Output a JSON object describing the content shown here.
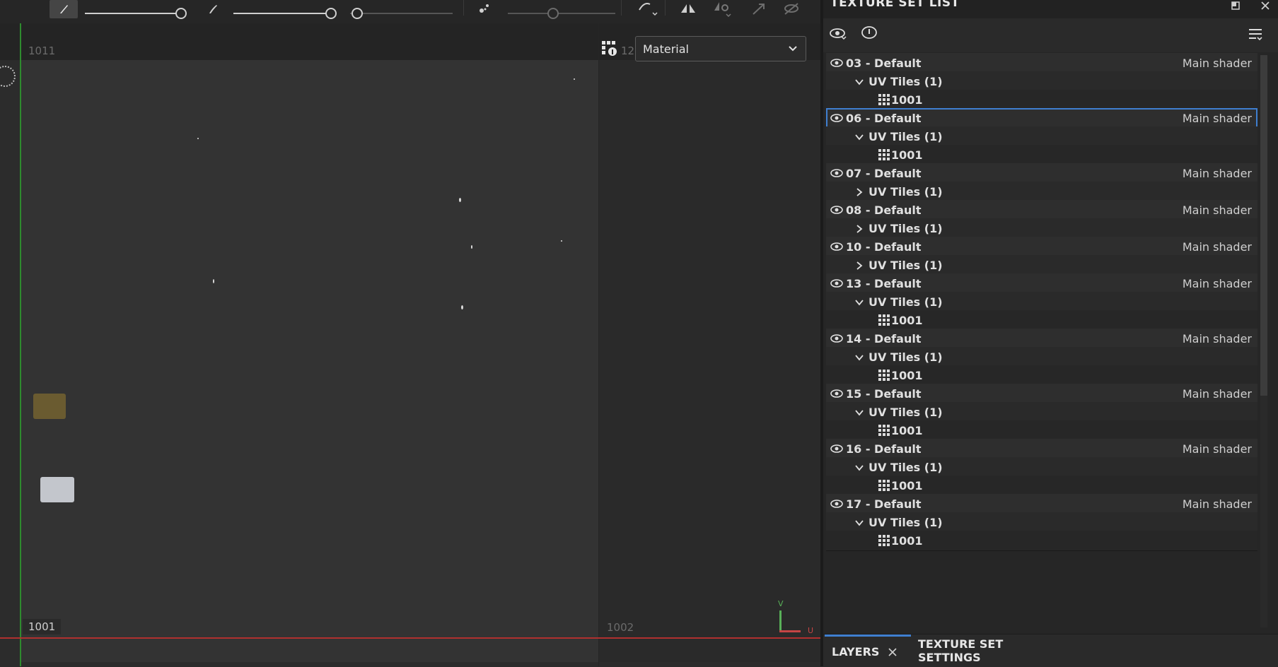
{
  "toolbar": {
    "icons": [
      "brush-icon",
      "stroke-icon",
      "scatter-icon",
      "curve-icon",
      "symmetry-icon",
      "settings-icon",
      "transform-icon",
      "hide-icon"
    ]
  },
  "viewport": {
    "tile_labels": {
      "top_left": "1011",
      "top_right": "12",
      "bottom_left": "1001",
      "bottom_right": "1002"
    },
    "material_select": {
      "value": "Material"
    },
    "axis": {
      "v_label": "V",
      "u_label": "U",
      "v_color": "#58b058",
      "u_color": "#c64545"
    },
    "thumbnails": [
      {
        "color": "#6a5b30"
      },
      {
        "color": "#c3c6cc"
      }
    ]
  },
  "panel": {
    "title": "TEXTURE SET LIST",
    "rows": [
      {
        "level": 0,
        "name": "03 - Default",
        "shader": "Main shader"
      },
      {
        "level": 1,
        "name": "UV Tiles (1)",
        "expanded": true
      },
      {
        "level": 2,
        "name": "1001"
      },
      {
        "level": 0,
        "name": "06 - Default",
        "shader": "Main shader",
        "selected": true
      },
      {
        "level": 1,
        "name": "UV Tiles (1)",
        "expanded": true
      },
      {
        "level": 2,
        "name": "1001"
      },
      {
        "level": 0,
        "name": "07 - Default",
        "shader": "Main shader"
      },
      {
        "level": 1,
        "name": "UV Tiles (1)",
        "expanded": false
      },
      {
        "level": 0,
        "name": "08 - Default",
        "shader": "Main shader"
      },
      {
        "level": 1,
        "name": "UV Tiles (1)",
        "expanded": false
      },
      {
        "level": 0,
        "name": "10 - Default",
        "shader": "Main shader"
      },
      {
        "level": 1,
        "name": "UV Tiles (1)",
        "expanded": false
      },
      {
        "level": 0,
        "name": "13 - Default",
        "shader": "Main shader"
      },
      {
        "level": 1,
        "name": "UV Tiles (1)",
        "expanded": true
      },
      {
        "level": 2,
        "name": "1001"
      },
      {
        "level": 0,
        "name": "14 - Default",
        "shader": "Main shader"
      },
      {
        "level": 1,
        "name": "UV Tiles (1)",
        "expanded": true
      },
      {
        "level": 2,
        "name": "1001"
      },
      {
        "level": 0,
        "name": "15 - Default",
        "shader": "Main shader"
      },
      {
        "level": 1,
        "name": "UV Tiles (1)",
        "expanded": true
      },
      {
        "level": 2,
        "name": "1001"
      },
      {
        "level": 0,
        "name": "16 - Default",
        "shader": "Main shader"
      },
      {
        "level": 1,
        "name": "UV Tiles (1)",
        "expanded": true
      },
      {
        "level": 2,
        "name": "1001"
      },
      {
        "level": 0,
        "name": "17 - Default",
        "shader": "Main shader"
      },
      {
        "level": 1,
        "name": "UV Tiles (1)",
        "expanded": true
      },
      {
        "level": 2,
        "name": "1001"
      }
    ],
    "tabs": {
      "layers": "LAYERS",
      "texture_set_settings": "TEXTURE SET SETTINGS"
    }
  },
  "colors": {
    "accent": "#3f7fd0",
    "u_axis": "#b0302f",
    "v_axis": "#2e8b2e"
  }
}
